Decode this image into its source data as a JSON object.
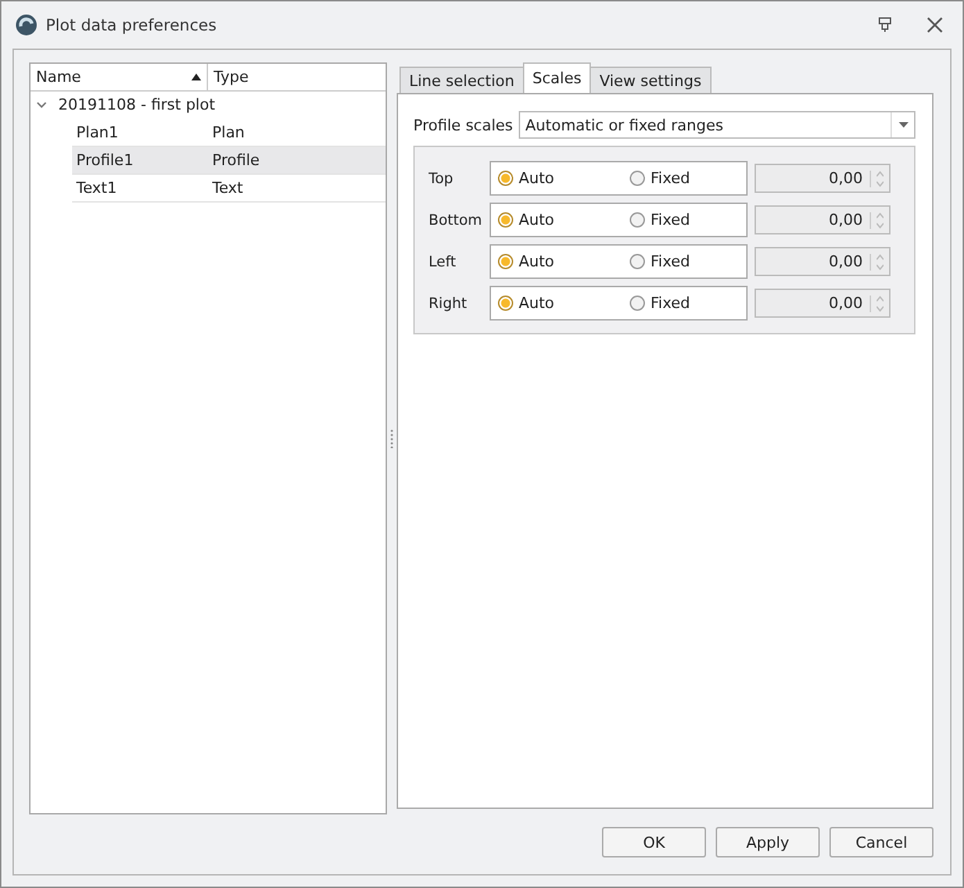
{
  "window": {
    "title": "Plot data preferences"
  },
  "tree": {
    "columns": [
      {
        "label": "Name",
        "sorted": true
      },
      {
        "label": "Type",
        "sorted": false
      }
    ],
    "nodes": [
      {
        "name": "20191108 - first plot",
        "expanded": true,
        "selected": false,
        "children": [
          {
            "name": "Plan1",
            "type": "Plan",
            "selected": false
          },
          {
            "name": "Profile1",
            "type": "Profile",
            "selected": true
          },
          {
            "name": "Text1",
            "type": "Text",
            "selected": false
          }
        ]
      }
    ]
  },
  "tabs": [
    {
      "label": "Line selection",
      "selected": false
    },
    {
      "label": "Scales",
      "selected": true
    },
    {
      "label": "View settings",
      "selected": false
    }
  ],
  "profile_scales": {
    "label": "Profile scales",
    "value": "Automatic or fixed ranges"
  },
  "scales": [
    {
      "label": "Top",
      "options": [
        {
          "label": "Auto",
          "selected": true
        },
        {
          "label": "Fixed",
          "selected": false
        }
      ],
      "value": "0,00",
      "disabled": true
    },
    {
      "label": "Bottom",
      "options": [
        {
          "label": "Auto",
          "selected": true
        },
        {
          "label": "Fixed",
          "selected": false
        }
      ],
      "value": "0,00",
      "disabled": true
    },
    {
      "label": "Left",
      "options": [
        {
          "label": "Auto",
          "selected": true
        },
        {
          "label": "Fixed",
          "selected": false
        }
      ],
      "value": "0,00",
      "disabled": true
    },
    {
      "label": "Right",
      "options": [
        {
          "label": "Auto",
          "selected": true
        },
        {
          "label": "Fixed",
          "selected": false
        }
      ],
      "value": "0,00",
      "disabled": true
    }
  ],
  "buttons": [
    "OK",
    "Apply",
    "Cancel"
  ]
}
